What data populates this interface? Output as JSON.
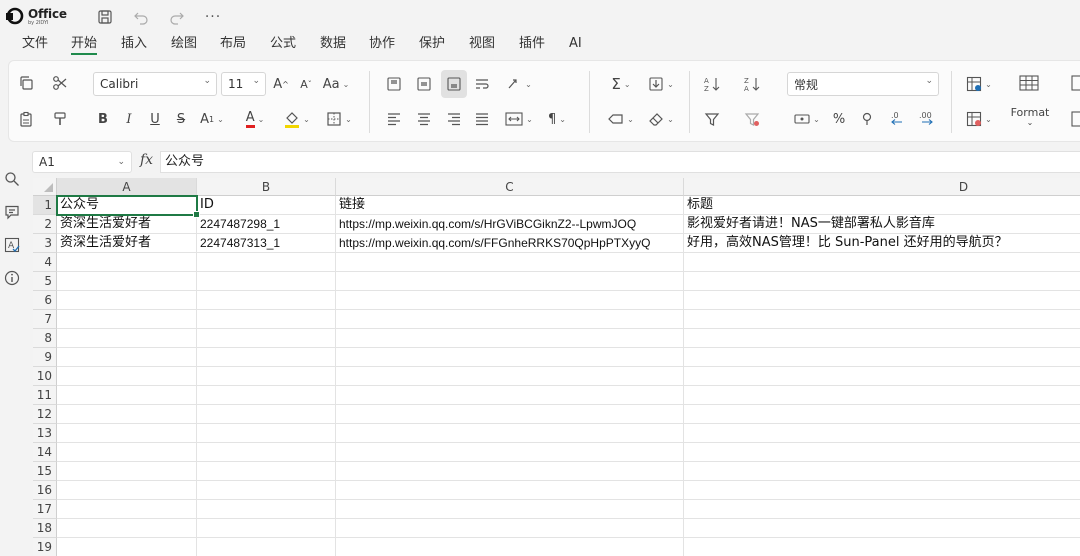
{
  "app": {
    "logo_text": "Office",
    "logo_sub": "by 2IDYI"
  },
  "menu": [
    "文件",
    "开始",
    "插入",
    "绘图",
    "布局",
    "公式",
    "数据",
    "协作",
    "保护",
    "视图",
    "插件",
    "AI"
  ],
  "menu_active_index": 1,
  "ribbon": {
    "font_name": "Calibri",
    "font_size": "11",
    "number_format": "常规",
    "format_label": "Format",
    "accent_red": "#e02020",
    "accent_yellow": "#f2d600"
  },
  "formula_bar": {
    "name_box": "A1",
    "fx": "fx",
    "content": "公众号"
  },
  "columns": [
    {
      "label": "A"
    },
    {
      "label": "B"
    },
    {
      "label": "C"
    },
    {
      "label": "D"
    }
  ],
  "rows": [
    {
      "n": "1",
      "cells": [
        "公众号",
        "ID",
        "链接",
        "标题"
      ]
    },
    {
      "n": "2",
      "cells": [
        "资深生活爱好者",
        "2247487298_1",
        "https://mp.weixin.qq.com/s/HrGViBCGiknZ2--LpwmJOQ",
        "影视爱好者请进！NAS一键部署私人影音库"
      ]
    },
    {
      "n": "3",
      "cells": [
        "资深生活爱好者",
        "2247487313_1",
        "https://mp.weixin.qq.com/s/FFGnheRRKS70QpHpPTXyyQ",
        "好用，高效NAS管理！比 Sun-Panel 还好用的导航页？"
      ]
    },
    {
      "n": "4",
      "cells": [
        "",
        "",
        "",
        ""
      ]
    },
    {
      "n": "5",
      "cells": [
        "",
        "",
        "",
        ""
      ]
    },
    {
      "n": "6",
      "cells": [
        "",
        "",
        "",
        ""
      ]
    },
    {
      "n": "7",
      "cells": [
        "",
        "",
        "",
        ""
      ]
    },
    {
      "n": "8",
      "cells": [
        "",
        "",
        "",
        ""
      ]
    },
    {
      "n": "9",
      "cells": [
        "",
        "",
        "",
        ""
      ]
    },
    {
      "n": "10",
      "cells": [
        "",
        "",
        "",
        ""
      ]
    },
    {
      "n": "11",
      "cells": [
        "",
        "",
        "",
        ""
      ]
    },
    {
      "n": "12",
      "cells": [
        "",
        "",
        "",
        ""
      ]
    },
    {
      "n": "13",
      "cells": [
        "",
        "",
        "",
        ""
      ]
    },
    {
      "n": "14",
      "cells": [
        "",
        "",
        "",
        ""
      ]
    },
    {
      "n": "15",
      "cells": [
        "",
        "",
        "",
        ""
      ]
    },
    {
      "n": "16",
      "cells": [
        "",
        "",
        "",
        ""
      ]
    },
    {
      "n": "17",
      "cells": [
        "",
        "",
        "",
        ""
      ]
    },
    {
      "n": "18",
      "cells": [
        "",
        "",
        "",
        ""
      ]
    },
    {
      "n": "19",
      "cells": [
        "",
        "",
        "",
        ""
      ]
    }
  ],
  "selection": {
    "active_cell": "A1"
  }
}
